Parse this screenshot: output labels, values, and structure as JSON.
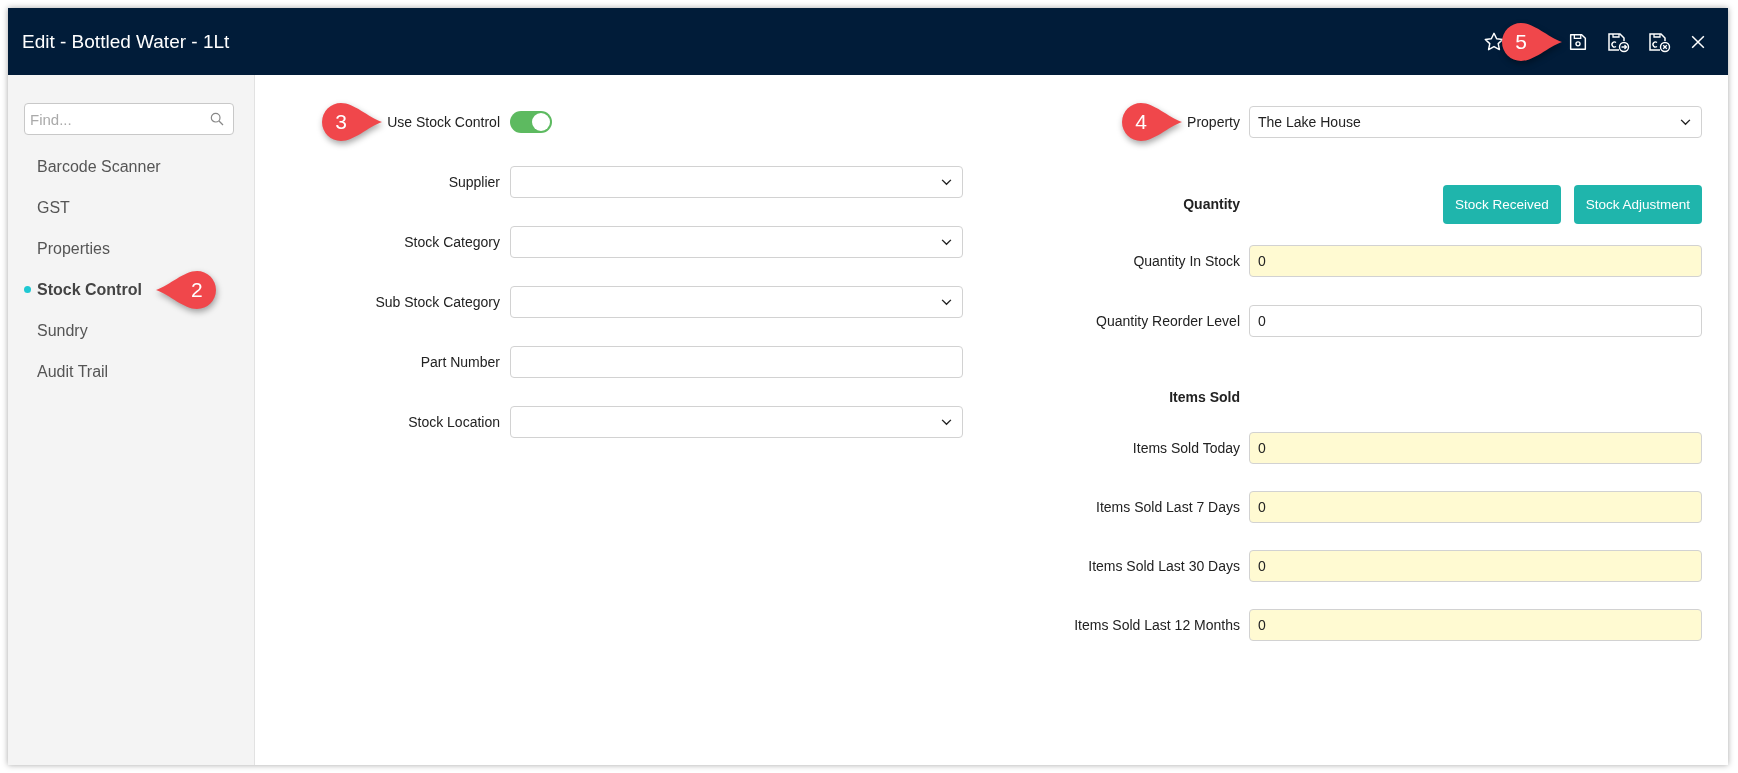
{
  "window": {
    "title": "Edit - Bottled Water - 1Lt",
    "callout": "5"
  },
  "sidebar": {
    "search": {
      "placeholder": "Find..."
    },
    "items": [
      {
        "label": "Barcode Scanner",
        "selected": false
      },
      {
        "label": "GST",
        "selected": false
      },
      {
        "label": "Properties",
        "selected": false
      },
      {
        "label": "Stock Control",
        "selected": true,
        "callout": "2"
      },
      {
        "label": "Sundry",
        "selected": false
      },
      {
        "label": "Audit Trail",
        "selected": false
      }
    ]
  },
  "left_form": {
    "toggle": {
      "label": "Use Stock Control",
      "on": true,
      "callout": "3"
    },
    "fields": [
      {
        "label": "Supplier",
        "kind": "select"
      },
      {
        "label": "Stock Category",
        "kind": "select"
      },
      {
        "label": "Sub Stock Category",
        "kind": "select"
      },
      {
        "label": "Part Number",
        "kind": "text"
      },
      {
        "label": "Stock Location",
        "kind": "select"
      }
    ]
  },
  "right_form": {
    "property": {
      "label": "Property",
      "value": "The Lake House",
      "callout": "4"
    },
    "quantity": {
      "heading": "Quantity",
      "buttons": [
        "Stock Received",
        "Stock Adjustment"
      ],
      "fields": [
        {
          "label": "Quantity In Stock",
          "value": "0",
          "readonly": true
        },
        {
          "label": "Quantity Reorder Level",
          "value": "0",
          "readonly": false
        }
      ]
    },
    "items_sold": {
      "heading": "Items Sold",
      "fields": [
        {
          "label": "Items Sold Today",
          "value": "0",
          "readonly": true
        },
        {
          "label": "Items Sold Last 7 Days",
          "value": "0",
          "readonly": true
        },
        {
          "label": "Items Sold Last 30 Days",
          "value": "0",
          "readonly": true
        },
        {
          "label": "Items Sold Last 12 Months",
          "value": "0",
          "readonly": true
        }
      ]
    }
  }
}
